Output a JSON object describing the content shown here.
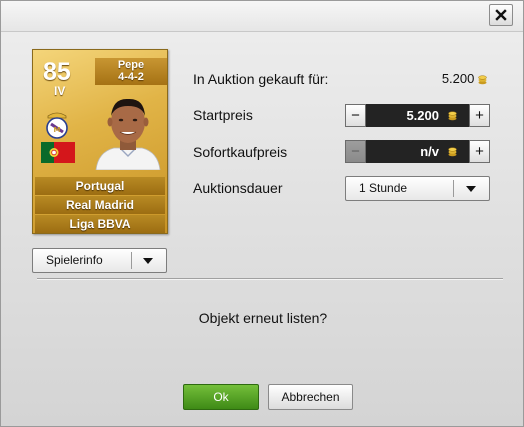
{
  "dialog": {
    "close_icon": "close-icon"
  },
  "player_card": {
    "rating": "85",
    "position": "IV",
    "name": "Pepe",
    "formation": "4-4-2",
    "nation": "Portugal",
    "club": "Real Madrid",
    "league": "Liga BBVA",
    "club_badge_icon": "real-madrid-crest-icon",
    "flag_icon": "portugal-flag-icon",
    "colors": {
      "gold_light": "#f4d57a",
      "gold_dark": "#c89325"
    }
  },
  "player_info_dropdown": {
    "label": "Spielerinfo"
  },
  "auction": {
    "bought_label": "In Auktion gekauft für:",
    "bought_value": "5.200",
    "start_price_label": "Startpreis",
    "start_price_value": "5.200",
    "buy_now_label": "Sofortkaufpreis",
    "buy_now_value": "n/v",
    "duration_label": "Auktionsdauer",
    "duration_value": "1 Stunde",
    "coin_icon": "coins-icon",
    "minus_symbol": "−",
    "plus_symbol": "+"
  },
  "question": "Objekt erneut listen?",
  "buttons": {
    "ok_label": "Ok",
    "cancel_label": "Abbrechen",
    "ok_color": "#4f9e22"
  }
}
